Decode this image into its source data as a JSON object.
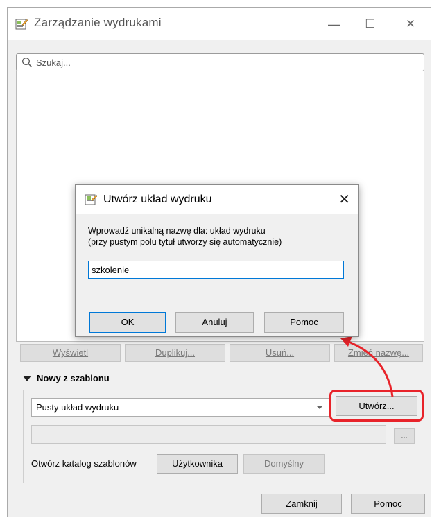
{
  "window": {
    "title": "Zarządzanie wydrukami",
    "minimize": "—",
    "maximize": "☐",
    "close": "✕"
  },
  "search": {
    "placeholder": "Szukaj..."
  },
  "actions": {
    "show": "Wyświetl",
    "duplicate": "Duplikuj...",
    "remove": "Usuń...",
    "rename": "Zmień nazwę..."
  },
  "template_section": {
    "title": "Nowy z szablonu",
    "template_select": "Pusty układ wydruku",
    "create_button": "Utwórz...",
    "browse_button": "...",
    "open_catalog_label": "Otwórz katalog szablonów",
    "user_button": "Użytkownika",
    "default_button": "Domyślny"
  },
  "footer": {
    "close_button": "Zamknij",
    "help_button": "Pomoc"
  },
  "dialog": {
    "title": "Utwórz układ wydruku",
    "close": "✕",
    "message_line1": "Wprowadź unikalną nazwę dla: układ wydruku",
    "message_line2": "(przy pustym polu tytuł utworzy się automatycznie)",
    "name_value": "szkolenie",
    "ok_button": "OK",
    "cancel_button": "Anuluj",
    "help_button": "Pomoc"
  },
  "colors": {
    "highlight": "#e8232a",
    "focus_border": "#0078d7"
  }
}
